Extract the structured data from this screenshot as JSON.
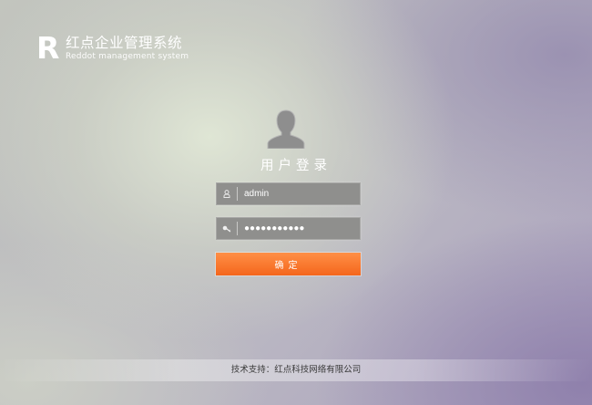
{
  "brand": {
    "mark": "R",
    "name_cn": "红点企业管理系统",
    "name_en": "Reddot management system"
  },
  "login": {
    "title": "用户登录",
    "username": {
      "value": "admin",
      "icon": "user-icon"
    },
    "password": {
      "value": "●●●●●●●●●●●",
      "icon": "key-icon"
    },
    "submit_label": "确定"
  },
  "footer": {
    "text": "技术支持：红点科技网络有限公司"
  },
  "colors": {
    "accent": "#f4661c",
    "field_bg": "#8f8f8d"
  }
}
